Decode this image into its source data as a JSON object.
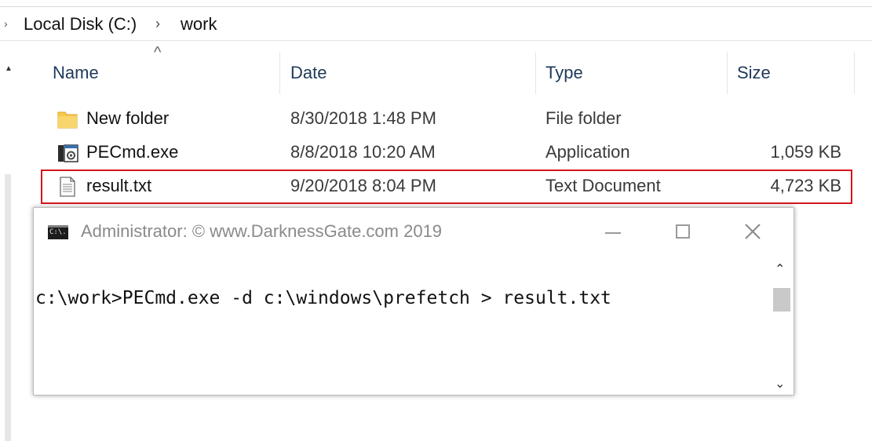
{
  "breadcrumb": {
    "items": [
      "Local Disk (C:)",
      "work"
    ],
    "separator": "›"
  },
  "columns": {
    "name": "Name",
    "date": "Date",
    "type": "Type",
    "size": "Size"
  },
  "files": [
    {
      "name": "New folder",
      "date": "8/30/2018 1:48 PM",
      "type": "File folder",
      "size": "",
      "icon": "folder-icon"
    },
    {
      "name": "PECmd.exe",
      "date": "8/8/2018 10:20 AM",
      "type": "Application",
      "size": "1,059 KB",
      "icon": "application-icon"
    },
    {
      "name": "result.txt",
      "date": "9/20/2018 8:04 PM",
      "type": "Text Document",
      "size": "4,723 KB",
      "icon": "text-document-icon",
      "highlighted": true
    }
  ],
  "console": {
    "title": "Administrator: © www.DarknessGate.com 2019",
    "icon_label": "C:\\.",
    "command": "c:\\work>PECmd.exe -d c:\\windows\\prefetch > result.txt"
  },
  "colors": {
    "highlight_border": "#d4161c",
    "header_text": "#1e3a5a",
    "folder_yellow": "#f7c84b"
  }
}
